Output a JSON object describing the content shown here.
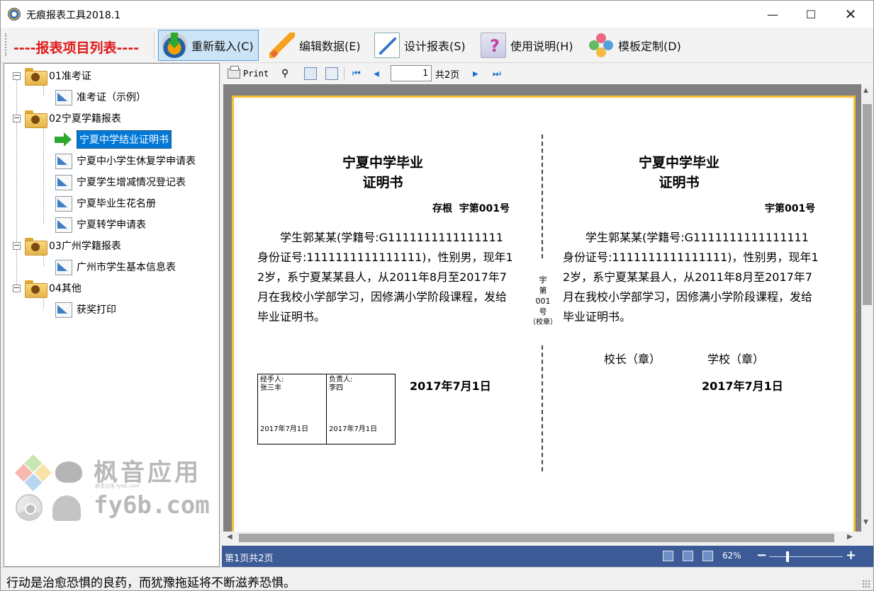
{
  "window": {
    "title": "无痕报表工具2018.1"
  },
  "toolbar": {
    "panel_title": "----报表项目列表----",
    "buttons": [
      {
        "label": "重新载入(C)",
        "icon": "reload-icon"
      },
      {
        "label": "编辑数据(E)",
        "icon": "pencil-icon"
      },
      {
        "label": "设计报表(S)",
        "icon": "design-icon"
      },
      {
        "label": "使用说明(H)",
        "icon": "help-icon"
      },
      {
        "label": "模板定制(D)",
        "icon": "template-icon"
      }
    ]
  },
  "tree": {
    "groups": [
      {
        "label": "01准考证",
        "items": [
          "准考证（示例）"
        ]
      },
      {
        "label": "02宁夏学籍报表",
        "items": [
          "宁夏中学结业证明书",
          "宁夏中小学生休复学申请表",
          "宁夏学生增减情况登记表",
          "宁夏毕业生花名册",
          "宁夏转学申请表"
        ]
      },
      {
        "label": "03广州学籍报表",
        "items": [
          "广州市学生基本信息表"
        ]
      },
      {
        "label": "04其他",
        "items": [
          "获奖打印"
        ]
      }
    ],
    "selected": "宁夏中学结业证明书",
    "watermark": {
      "line1": "枫音应用",
      "line2": "fy6b.com",
      "small": "枫音应用 fy6b.com"
    }
  },
  "preview_toolbar": {
    "print_label": "Print",
    "page_current": "1",
    "page_total_label": "共2页"
  },
  "certificate": {
    "left": {
      "title_line1": "宁夏中学毕业",
      "title_line2": "证明书",
      "number": "存根  宇第001号",
      "body": "学生郭某某(学籍号:G1111111111111111身份证号:1111111111111111)，性别男，现年12岁，系宁夏某某县人，从2011年8月至2017年7月在我校小学部学习，因修满小学阶段课程，发给毕业证明书。",
      "date": "2017年7月1日",
      "sign": {
        "issuer_label": "经手人:",
        "issuer_name": "张三丰",
        "issuer_date": "2017年7月1日",
        "owner_label": "负责人:",
        "owner_name": "李四",
        "owner_date": "2017年7月1日"
      }
    },
    "seal": [
      "宇",
      "第",
      "001",
      "号",
      "（校章）"
    ],
    "right": {
      "title_line1": "宁夏中学毕业",
      "title_line2": "证明书",
      "number": "宇第001号",
      "body": "学生郭某某(学籍号:G1111111111111111身份证号:1111111111111111)，性别男，现年12岁，系宁夏某某县人，从2011年8月至2017年7月在我校小学部学习，因修满小学阶段课程，发给毕业证明书。",
      "principal": "校长（章）",
      "school": "学校（章）",
      "date": "2017年7月1日"
    }
  },
  "preview_status": {
    "page_info": "第1页共2页",
    "zoom": "62%",
    "zoom_minus": "−",
    "zoom_plus": "+",
    "zoom_level": 0.25
  },
  "statusbar": {
    "message": "行动是治愈恐惧的良药，而犹豫拖延将不断滋养恐惧。"
  }
}
